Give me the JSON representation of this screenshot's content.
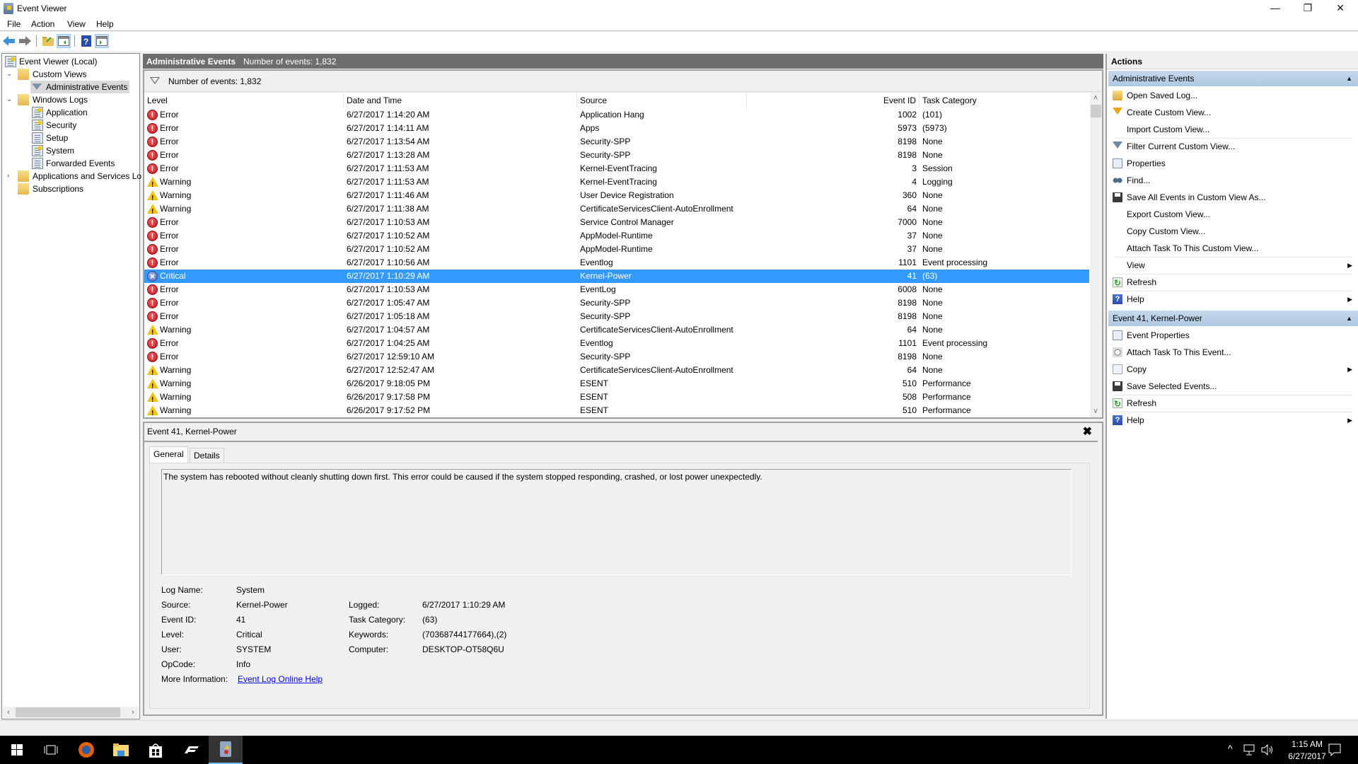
{
  "window": {
    "title": "Event Viewer",
    "controls": {
      "minimize": "—",
      "restore": "❐",
      "close": "✕"
    }
  },
  "menu": [
    "File",
    "Action",
    "View",
    "Help"
  ],
  "toolbar": {
    "buttons": [
      "back-icon",
      "forward-icon",
      "open-folder-icon",
      "show-hide-console-tree-icon",
      "help-icon",
      "show-hide-action-pane-icon"
    ]
  },
  "tree": {
    "items": [
      {
        "label": "Event Viewer (Local)",
        "icon": "event-viewer-icon"
      },
      {
        "label": "Custom Views",
        "icon": "folder-filter-icon",
        "expanded": true
      },
      {
        "label": "Administrative Events",
        "icon": "filter-icon",
        "selected": true
      },
      {
        "label": "Windows Logs",
        "icon": "folder-computer-icon",
        "expanded": true
      },
      {
        "label": "Application",
        "icon": "log-warning-icon"
      },
      {
        "label": "Security",
        "icon": "log-warning-icon"
      },
      {
        "label": "Setup",
        "icon": "log-icon"
      },
      {
        "label": "System",
        "icon": "log-warning-icon"
      },
      {
        "label": "Forwarded Events",
        "icon": "log-icon"
      },
      {
        "label": "Applications and Services Lo",
        "icon": "folder-icon",
        "expanded": false
      },
      {
        "label": "Subscriptions",
        "icon": "subscriptions-icon"
      }
    ],
    "expand_glyph": "⌄",
    "collapse_glyph": "›"
  },
  "center": {
    "header_title": "Administrative Events",
    "header_count": "Number of events: 1,832",
    "filter_text": "Number of events: 1,832",
    "columns": [
      "Level",
      "Date and Time",
      "Source",
      "Event ID",
      "Task Category"
    ],
    "rows": [
      {
        "level": "Error",
        "date": "6/27/2017 1:14:20 AM",
        "source": "Application Hang",
        "id": "1002",
        "category": "(101)"
      },
      {
        "level": "Error",
        "date": "6/27/2017 1:14:11 AM",
        "source": "Apps",
        "id": "5973",
        "category": "(5973)"
      },
      {
        "level": "Error",
        "date": "6/27/2017 1:13:54 AM",
        "source": "Security-SPP",
        "id": "8198",
        "category": "None"
      },
      {
        "level": "Error",
        "date": "6/27/2017 1:13:28 AM",
        "source": "Security-SPP",
        "id": "8198",
        "category": "None"
      },
      {
        "level": "Error",
        "date": "6/27/2017 1:11:53 AM",
        "source": "Kernel-EventTracing",
        "id": "3",
        "category": "Session"
      },
      {
        "level": "Warning",
        "date": "6/27/2017 1:11:53 AM",
        "source": "Kernel-EventTracing",
        "id": "4",
        "category": "Logging"
      },
      {
        "level": "Warning",
        "date": "6/27/2017 1:11:46 AM",
        "source": "User Device Registration",
        "id": "360",
        "category": "None"
      },
      {
        "level": "Warning",
        "date": "6/27/2017 1:11:38 AM",
        "source": "CertificateServicesClient-AutoEnrollment",
        "id": "64",
        "category": "None"
      },
      {
        "level": "Error",
        "date": "6/27/2017 1:10:53 AM",
        "source": "Service Control Manager",
        "id": "7000",
        "category": "None"
      },
      {
        "level": "Error",
        "date": "6/27/2017 1:10:52 AM",
        "source": "AppModel-Runtime",
        "id": "37",
        "category": "None"
      },
      {
        "level": "Error",
        "date": "6/27/2017 1:10:52 AM",
        "source": "AppModel-Runtime",
        "id": "37",
        "category": "None"
      },
      {
        "level": "Error",
        "date": "6/27/2017 1:10:56 AM",
        "source": "Eventlog",
        "id": "1101",
        "category": "Event processing"
      },
      {
        "level": "Critical",
        "date": "6/27/2017 1:10:29 AM",
        "source": "Kernel-Power",
        "id": "41",
        "category": "(63)",
        "selected": true
      },
      {
        "level": "Error",
        "date": "6/27/2017 1:10:53 AM",
        "source": "EventLog",
        "id": "6008",
        "category": "None"
      },
      {
        "level": "Error",
        "date": "6/27/2017 1:05:47 AM",
        "source": "Security-SPP",
        "id": "8198",
        "category": "None"
      },
      {
        "level": "Error",
        "date": "6/27/2017 1:05:18 AM",
        "source": "Security-SPP",
        "id": "8198",
        "category": "None"
      },
      {
        "level": "Warning",
        "date": "6/27/2017 1:04:57 AM",
        "source": "CertificateServicesClient-AutoEnrollment",
        "id": "64",
        "category": "None"
      },
      {
        "level": "Error",
        "date": "6/27/2017 1:04:25 AM",
        "source": "Eventlog",
        "id": "1101",
        "category": "Event processing"
      },
      {
        "level": "Error",
        "date": "6/27/2017 12:59:10 AM",
        "source": "Security-SPP",
        "id": "8198",
        "category": "None"
      },
      {
        "level": "Warning",
        "date": "6/27/2017 12:52:47 AM",
        "source": "CertificateServicesClient-AutoEnrollment",
        "id": "64",
        "category": "None"
      },
      {
        "level": "Warning",
        "date": "6/26/2017 9:18:05 PM",
        "source": "ESENT",
        "id": "510",
        "category": "Performance"
      },
      {
        "level": "Warning",
        "date": "6/26/2017 9:17:58 PM",
        "source": "ESENT",
        "id": "508",
        "category": "Performance"
      },
      {
        "level": "Warning",
        "date": "6/26/2017 9:17:52 PM",
        "source": "ESENT",
        "id": "510",
        "category": "Performance"
      }
    ]
  },
  "details": {
    "title": "Event 41, Kernel-Power",
    "close_glyph": "✖",
    "tabs": [
      "General",
      "Details"
    ],
    "active_tab": "General",
    "message": "The system has rebooted without cleanly shutting down first. This error could be caused if the system stopped responding, crashed, or lost power unexpectedly.",
    "fields_left": [
      {
        "label": "Log Name:",
        "value": "System"
      },
      {
        "label": "Source:",
        "value": "Kernel-Power"
      },
      {
        "label": "Event ID:",
        "value": "41"
      },
      {
        "label": "Level:",
        "value": "Critical"
      },
      {
        "label": "User:",
        "value": "SYSTEM"
      },
      {
        "label": "OpCode:",
        "value": "Info"
      }
    ],
    "fields_right": [
      {
        "label": "Logged:",
        "value": "6/27/2017 1:10:29 AM"
      },
      {
        "label": "Task Category:",
        "value": "(63)"
      },
      {
        "label": "Keywords:",
        "value": "(70368744177664),(2)"
      },
      {
        "label": "Computer:",
        "value": "DESKTOP-OT58Q6U"
      }
    ],
    "more_info_label": "More Information:",
    "more_info_link": "Event Log Online Help"
  },
  "actions": {
    "header": "Actions",
    "groups": [
      {
        "title": "Administrative Events",
        "items": [
          {
            "label": "Open Saved Log...",
            "icon": "open-folder-icon"
          },
          {
            "label": "Create Custom View...",
            "icon": "create-filter-icon"
          },
          {
            "label": "Import Custom View...",
            "icon": ""
          },
          {
            "sep": true
          },
          {
            "label": "Filter Current Custom View...",
            "icon": "filter-icon"
          },
          {
            "label": "Properties",
            "icon": "properties-icon"
          },
          {
            "label": "Find...",
            "icon": "binoculars-icon"
          },
          {
            "label": "Save All Events in Custom View As...",
            "icon": "save-icon"
          },
          {
            "label": "Export Custom View...",
            "icon": ""
          },
          {
            "label": "Copy Custom View...",
            "icon": ""
          },
          {
            "label": "Attach Task To This Custom View...",
            "icon": ""
          },
          {
            "sep": true
          },
          {
            "label": "View",
            "icon": "",
            "submenu": true
          },
          {
            "sep": true
          },
          {
            "label": "Refresh",
            "icon": "refresh-icon"
          },
          {
            "sep": true
          },
          {
            "label": "Help",
            "icon": "help-icon",
            "submenu": true
          }
        ]
      },
      {
        "title": "Event 41, Kernel-Power",
        "items": [
          {
            "label": "Event Properties",
            "icon": "properties-icon"
          },
          {
            "label": "Attach Task To This Event...",
            "icon": "task-clock-icon"
          },
          {
            "label": "Copy",
            "icon": "copy-icon",
            "submenu": true
          },
          {
            "label": "Save Selected Events...",
            "icon": "save-icon"
          },
          {
            "sep": true
          },
          {
            "label": "Refresh",
            "icon": "refresh-icon"
          },
          {
            "sep": true
          },
          {
            "label": "Help",
            "icon": "help-icon",
            "submenu": true
          }
        ]
      }
    ],
    "collapse_glyph": "▲",
    "submenu_glyph": "▶"
  },
  "taskbar": {
    "apps": [
      "start-icon",
      "task-view-icon",
      "firefox-icon",
      "file-explorer-icon",
      "store-icon",
      "forza-icon",
      "event-viewer-icon"
    ],
    "active_app": "event-viewer-icon",
    "tray": {
      "chevron": "^",
      "time": "1:15 AM",
      "date": "6/27/2017"
    }
  }
}
